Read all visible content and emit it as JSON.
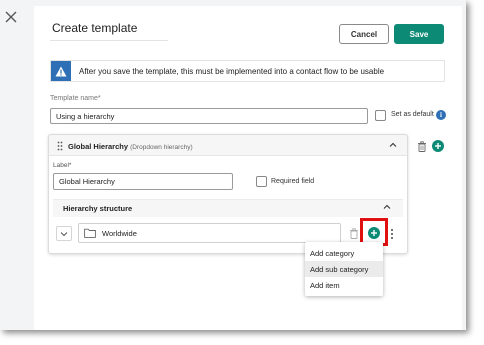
{
  "dialog": {
    "title": "Create template",
    "cancel_label": "Cancel",
    "save_label": "Save"
  },
  "alert": {
    "text": "After you save the template, this must be implemented into a contact flow to be usable",
    "icon": "warning-icon"
  },
  "template": {
    "name_label": "Template name*",
    "name_value": "Using a hierarchy",
    "set_default_label": "Set as default",
    "set_default_checked": false
  },
  "field_card": {
    "title": "Global Hierarchy",
    "subtitle": "(Dropdown hierarchy)",
    "label_caption": "Label*",
    "label_value": "Global Hierarchy",
    "required_label": "Required field",
    "required_checked": false
  },
  "hierarchy": {
    "title": "Hierarchy structure",
    "row_value": "Worldwide"
  },
  "context_menu": {
    "items": [
      "Add category",
      "Add sub category",
      "Add item"
    ],
    "active_index": 1
  },
  "colors": {
    "accent": "#0c8a76",
    "info": "#2f6fb5",
    "highlight": "#e01010"
  }
}
